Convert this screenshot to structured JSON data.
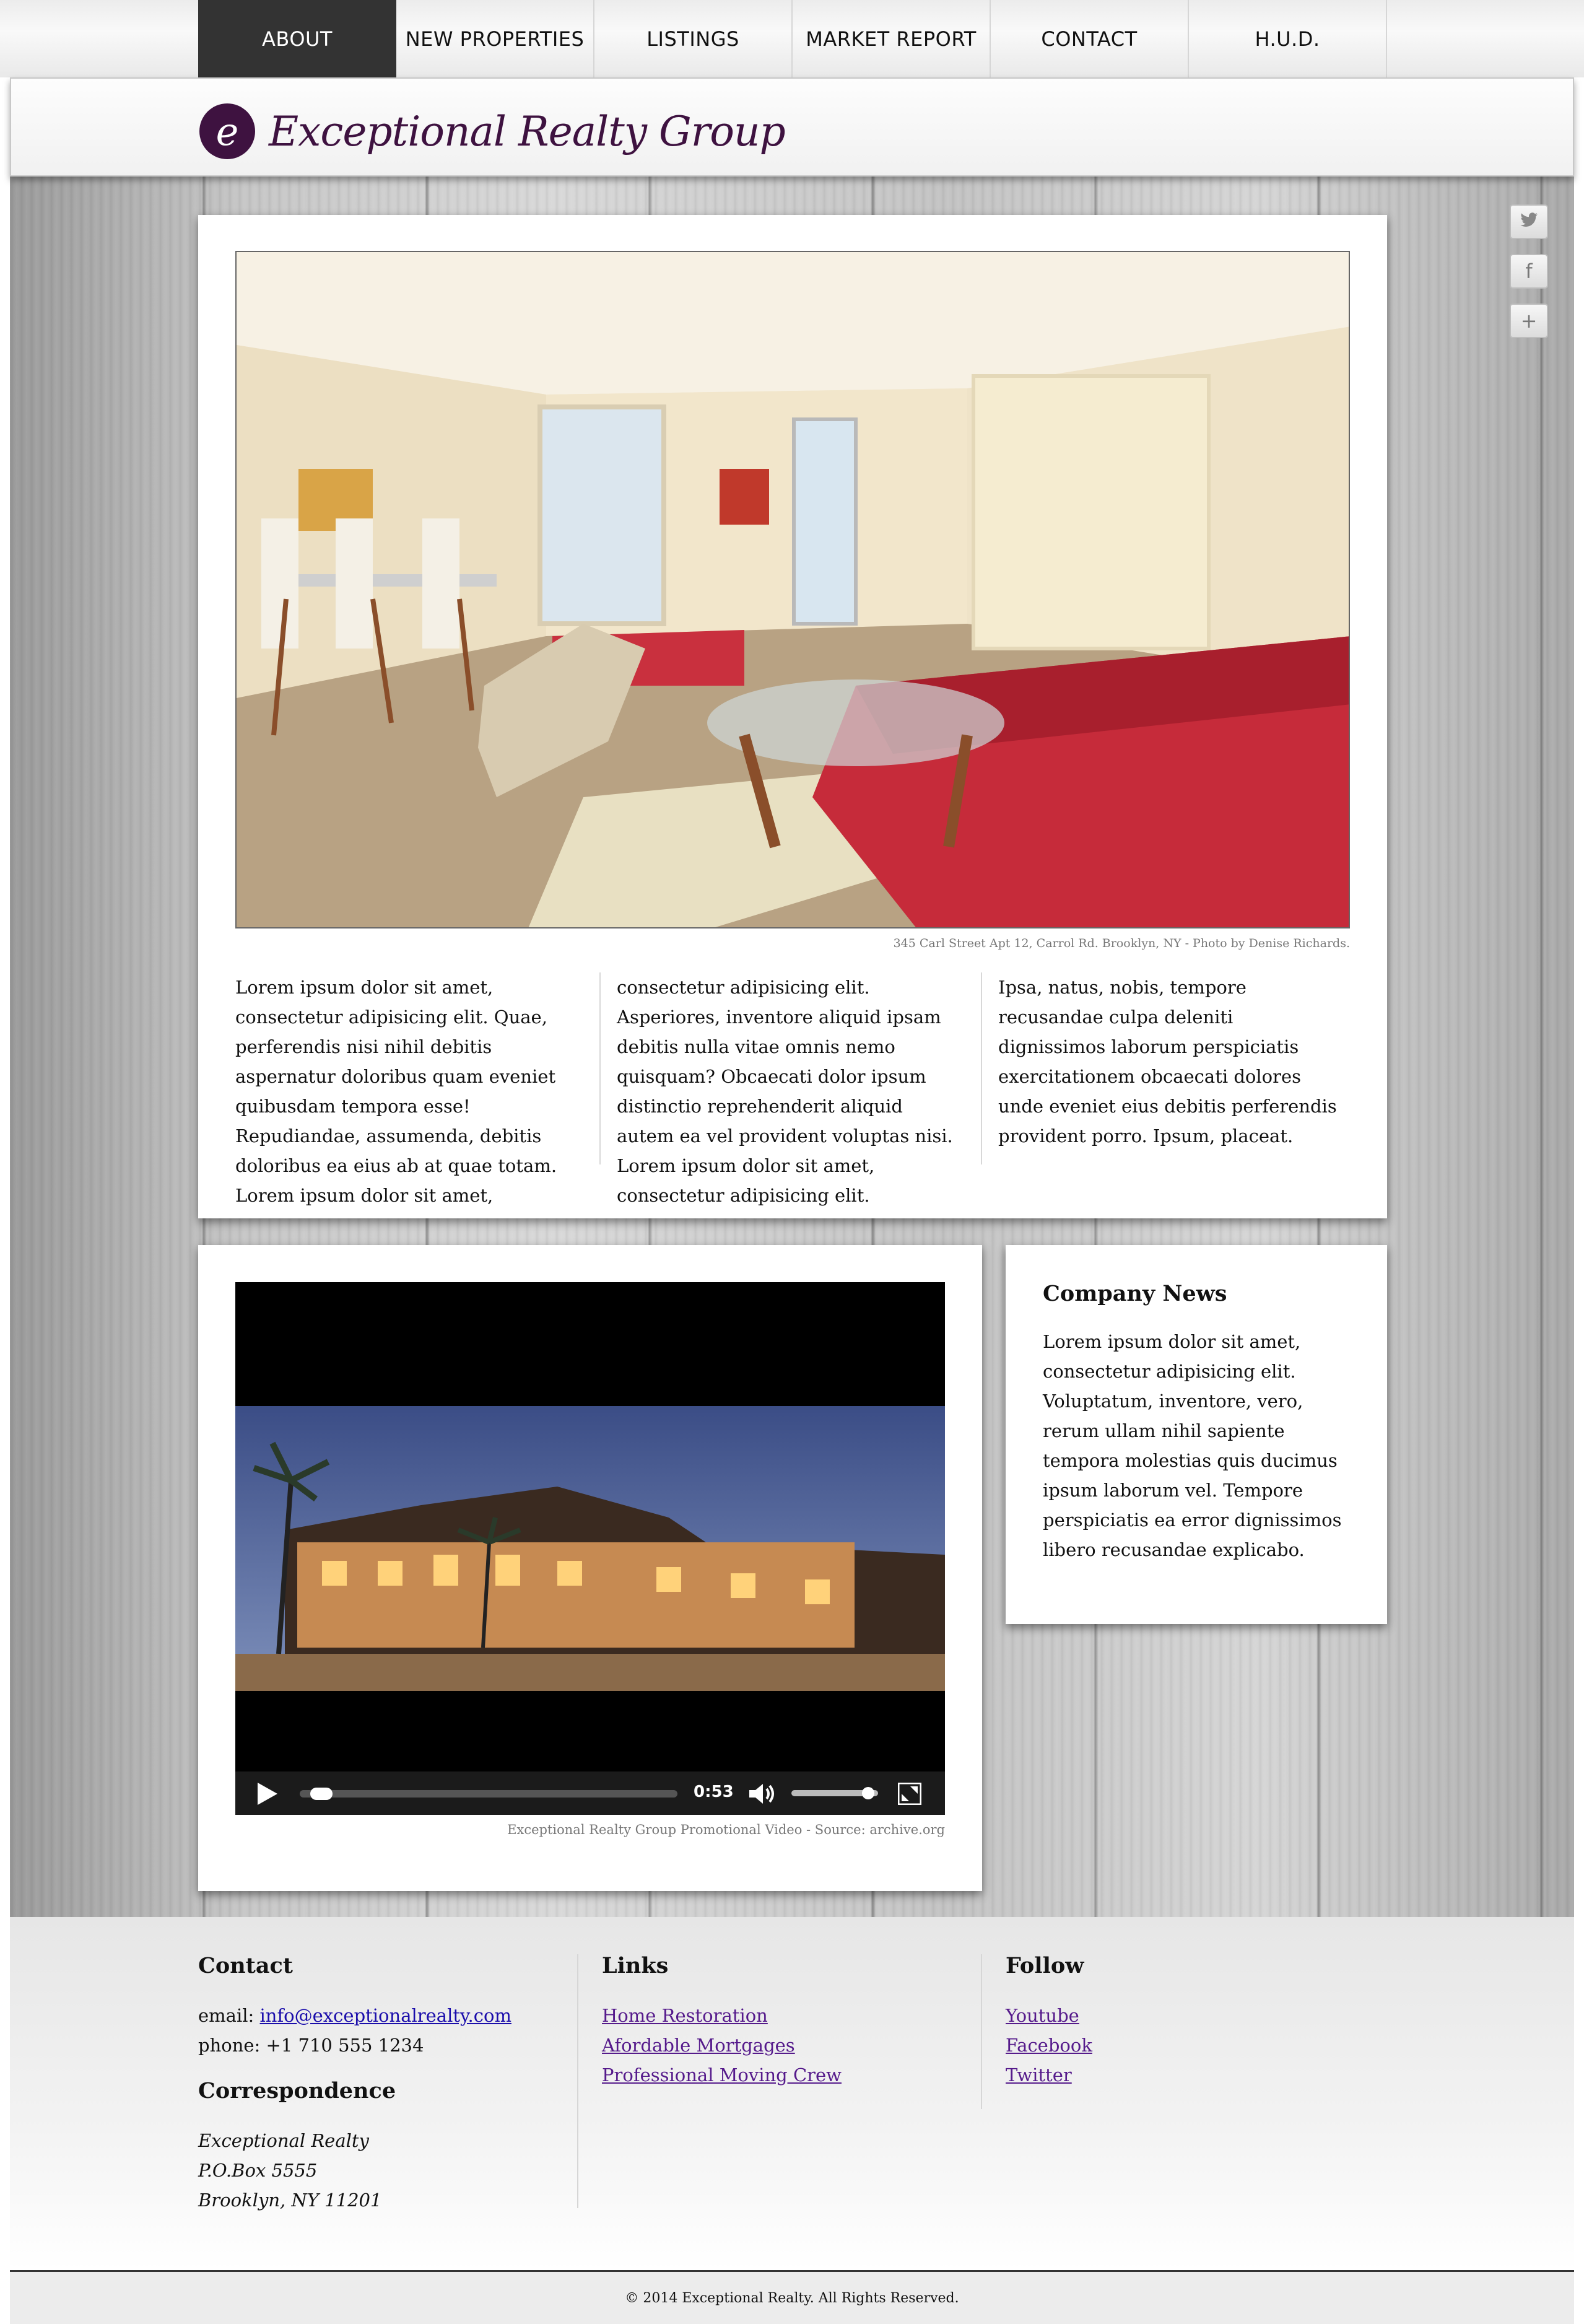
{
  "nav": {
    "items": [
      "ABOUT",
      "NEW PROPERTIES",
      "LISTINGS",
      "MARKET REPORT",
      "CONTACT",
      "H.U.D."
    ],
    "active": "ABOUT"
  },
  "header": {
    "logo_letter": "e",
    "logo_text": "Exceptional Realty Group"
  },
  "social": {
    "twitter_glyph": "🐦",
    "facebook_glyph": "f",
    "plus_glyph": "+"
  },
  "hero": {
    "caption": "345 Carl Street Apt 12, Carrol Rd. Brooklyn, NY - Photo by Denise Richards.",
    "columns": [
      "Lorem ipsum dolor sit amet, consectetur adipisicing elit. Quae, perferendis nisi nihil debitis aspernatur doloribus quam eveniet quibusdam tempora esse! Repudiandae, assumenda, debitis doloribus ea eius ab at quae totam. Lorem ipsum dolor sit amet,",
      "consectetur adipisicing elit. Asperiores, inventore aliquid ipsam debitis nulla vitae omnis nemo quisquam? Obcaecati dolor ipsum distinctio reprehenderit aliquid autem ea vel provident voluptas nisi. Lorem ipsum dolor sit amet, consectetur adipisicing elit.",
      "Ipsa, natus, nobis, tempore recusandae culpa deleniti dignissimos laborum perspiciatis exercitationem obcaecati dolores unde eveniet eius debitis perferendis provident porro. Ipsum, placeat."
    ]
  },
  "video": {
    "time": "0:53",
    "progress": 0.03,
    "volume": 0.95,
    "caption": "Exceptional Realty Group Promotional Video - Source: archive.org"
  },
  "news": {
    "title": "Company News",
    "body": "Lorem ipsum dolor sit amet, consectetur adipisicing elit. Voluptatum, inventore, vero, rerum ullam nihil sapiente tempora molestias quis ducimus ipsum laborum vel. Tempore perspiciatis ea error dignissimos libero recusandae explicabo."
  },
  "footer": {
    "contact": {
      "title": "Contact",
      "email_label": "email: ",
      "email": "info@exceptionalrealty.com",
      "phone": "phone: +1 710 555 1234"
    },
    "correspondence": {
      "title": "Correspondence",
      "lines": [
        "Exceptional Realty",
        "P.O.Box 5555",
        "Brooklyn, NY 11201"
      ]
    },
    "links": {
      "title": "Links",
      "items": [
        "Home Restoration",
        "Afordable Mortgages",
        "Professional Moving Crew"
      ]
    },
    "follow": {
      "title": "Follow",
      "items": [
        "Youtube",
        "Facebook",
        "Twitter"
      ]
    },
    "copyright": "© 2014 Exceptional Realty. All Rights Reserved."
  }
}
